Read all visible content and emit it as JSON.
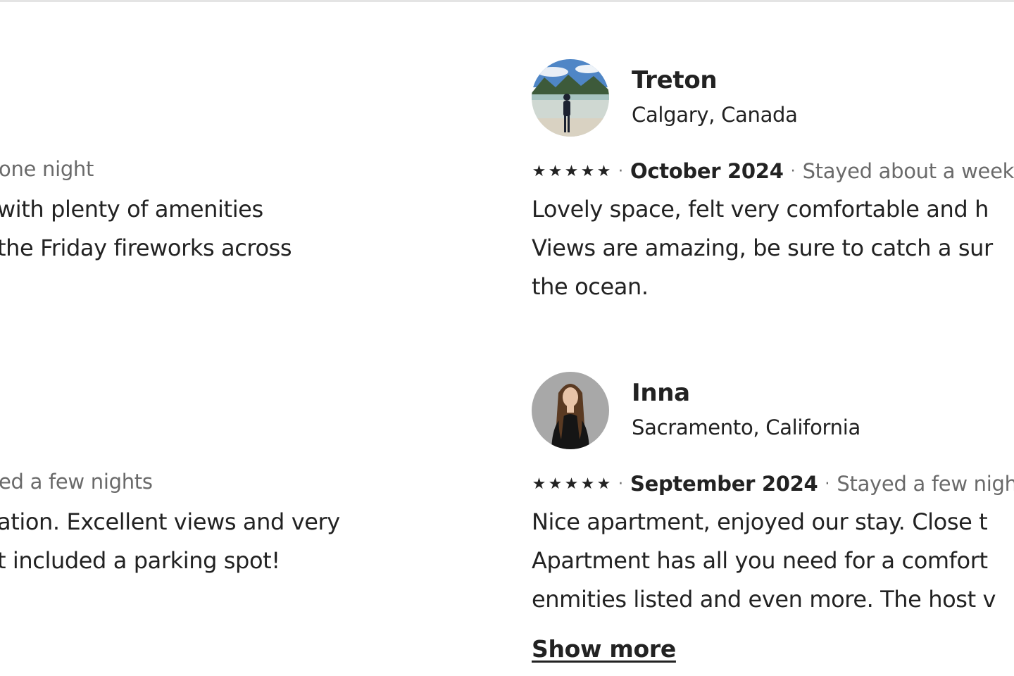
{
  "left_column": {
    "review1": {
      "stay_fragment": "one night",
      "body_lines": [
        "with plenty of amenities",
        "the Friday fireworks across"
      ]
    },
    "review2": {
      "stay_fragment": "ed a few nights",
      "body_lines": [
        "ation. Excellent views and very",
        "t included a parking spot!"
      ]
    }
  },
  "right_column": {
    "reviews": [
      {
        "name": "Treton",
        "location": "Calgary, Canada",
        "rating": 5,
        "date": "October 2024",
        "stay": "Stayed about a week",
        "body_lines": [
          "Lovely space, felt very comfortable and h",
          "Views are amazing, be sure to catch a sur",
          "the ocean."
        ],
        "avatar_colors": {
          "sky": "#4f86c6",
          "mountain": "#3d5a3a",
          "water": "#cfd8d2",
          "person": "#1c2230"
        }
      },
      {
        "name": "Inna",
        "location": "Sacramento, California",
        "rating": 5,
        "date": "September 2024",
        "stay": "Stayed a few nights",
        "body_lines": [
          "Nice apartment, enjoyed our stay. Close t",
          "Apartment has all you need for a comfort",
          "enmities listed and even more. The host v"
        ],
        "show_more": "Show more",
        "avatar_colors": {
          "bg": "#a8a8a8",
          "hair": "#5a3a22",
          "clothes": "#151515",
          "skin": "#e8c4a8"
        }
      }
    ]
  },
  "icons": {
    "star": "★",
    "dot": "·"
  },
  "colors": {
    "text": "#222222",
    "muted": "#6a6a6a",
    "divider": "#e4e4e4"
  }
}
